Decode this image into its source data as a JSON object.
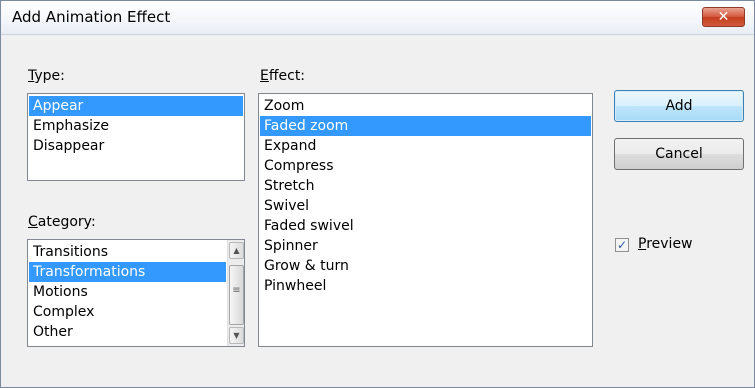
{
  "window": {
    "title": "Add Animation Effect",
    "close_glyph": "✕"
  },
  "type_section": {
    "label_accel": "T",
    "label_rest": "ype:",
    "items": [
      {
        "label": "Appear",
        "selected": true
      },
      {
        "label": "Emphasize",
        "selected": false
      },
      {
        "label": "Disappear",
        "selected": false
      }
    ]
  },
  "category_section": {
    "label_accel": "C",
    "label_rest": "ategory:",
    "items": [
      {
        "label": "Transitions",
        "selected": false
      },
      {
        "label": "Transformations",
        "selected": true
      },
      {
        "label": "Motions",
        "selected": false
      },
      {
        "label": "Complex",
        "selected": false
      },
      {
        "label": "Other",
        "selected": false
      }
    ]
  },
  "effect_section": {
    "label_accel": "E",
    "label_rest": "ffect:",
    "items": [
      {
        "label": "Zoom",
        "selected": false
      },
      {
        "label": "Faded zoom",
        "selected": true
      },
      {
        "label": "Expand",
        "selected": false
      },
      {
        "label": "Compress",
        "selected": false
      },
      {
        "label": "Stretch",
        "selected": false
      },
      {
        "label": "Swivel",
        "selected": false
      },
      {
        "label": "Faded swivel",
        "selected": false
      },
      {
        "label": "Spinner",
        "selected": false
      },
      {
        "label": "Grow & turn",
        "selected": false
      },
      {
        "label": "Pinwheel",
        "selected": false
      }
    ]
  },
  "buttons": {
    "add": "Add",
    "cancel": "Cancel"
  },
  "preview": {
    "label_accel": "P",
    "label_rest": "review",
    "checked": true
  },
  "colors": {
    "selection": "#3399ff",
    "dialog_bg": "#f0f0f0"
  }
}
